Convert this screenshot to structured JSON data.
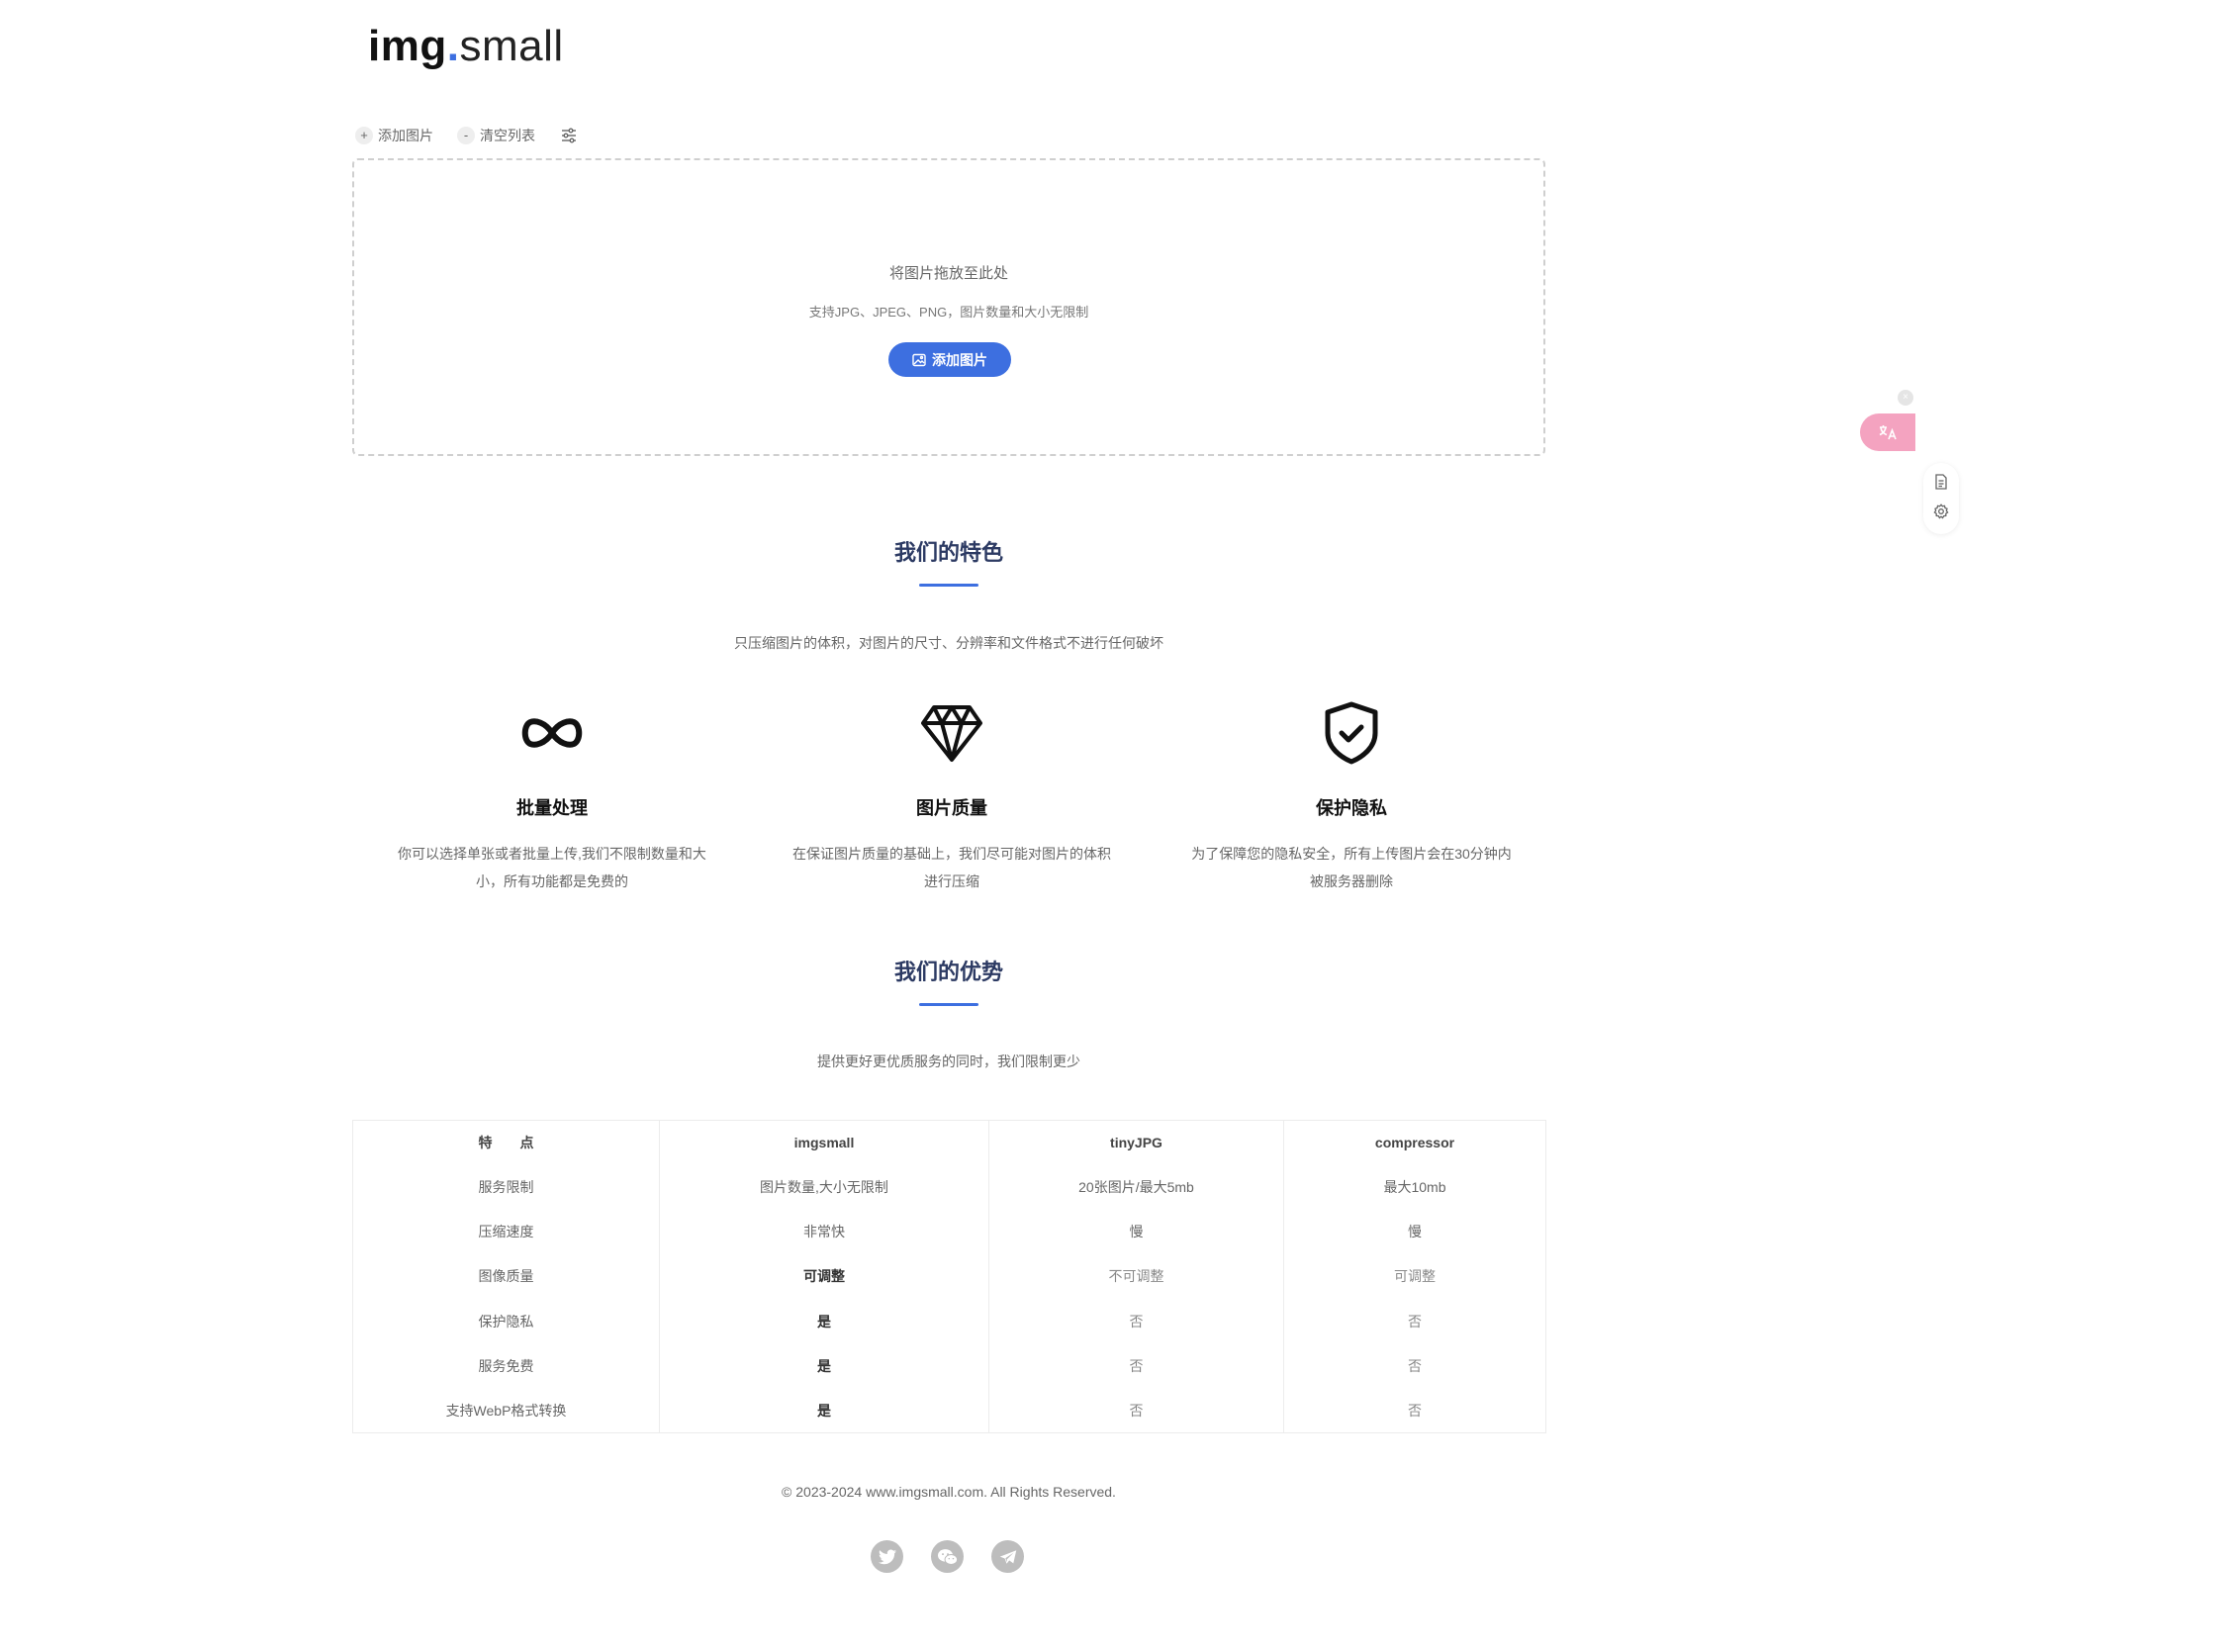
{
  "logo": {
    "bold": "img",
    "dot": ".",
    "thin": "small"
  },
  "toolbar": {
    "add_label": "添加图片",
    "add_icon": "+",
    "clear_label": "清空列表",
    "clear_icon": "-"
  },
  "dropzone": {
    "title": "将图片拖放至此处",
    "subtitle": "支持JPG、JPEG、PNG，图片数量和大小无限制",
    "button_label": "添加图片"
  },
  "features_section": {
    "title": "我们的特色",
    "subtitle": "只压缩图片的体积，对图片的尺寸、分辨率和文件格式不进行任何破坏",
    "items": [
      {
        "icon": "infinity-icon",
        "title": "批量处理",
        "desc": "你可以选择单张或者批量上传,我们不限制数量和大小，所有功能都是免费的"
      },
      {
        "icon": "diamond-icon",
        "title": "图片质量",
        "desc": "在保证图片质量的基础上，我们尽可能对图片的体积进行压缩"
      },
      {
        "icon": "shield-check-icon",
        "title": "保护隐私",
        "desc": "为了保障您的隐私安全，所有上传图片会在30分钟内被服务器删除"
      }
    ]
  },
  "advantages_section": {
    "title": "我们的优势",
    "subtitle": "提供更好更优质服务的同时，我们限制更少"
  },
  "compare_table": {
    "headers": [
      "特　　点",
      "imgsmall",
      "tinyJPG",
      "compressor"
    ],
    "rows": [
      [
        "服务限制",
        "图片数量,大小无限制",
        "20张图片/最大5mb",
        "最大10mb"
      ],
      [
        "压缩速度",
        "非常快",
        "慢",
        "慢"
      ],
      [
        "图像质量",
        "可调整",
        "不可调整",
        "可调整"
      ],
      [
        "保护隐私",
        "是",
        "否",
        "否"
      ],
      [
        "服务免费",
        "是",
        "否",
        "否"
      ],
      [
        "支持WebP格式转换",
        "是",
        "否",
        "否"
      ]
    ]
  },
  "footer": {
    "copyright": "© 2023-2024 www.imgsmall.com. All Rights Reserved."
  },
  "socials": [
    "twitter-icon",
    "wechat-icon",
    "telegram-icon"
  ],
  "floating": {
    "close_icon": "×",
    "translate_icon": "translate-icon"
  },
  "colors": {
    "accent": "#3d6fe0",
    "title": "#2c3a63",
    "translate_pill": "#f4a3c0"
  }
}
